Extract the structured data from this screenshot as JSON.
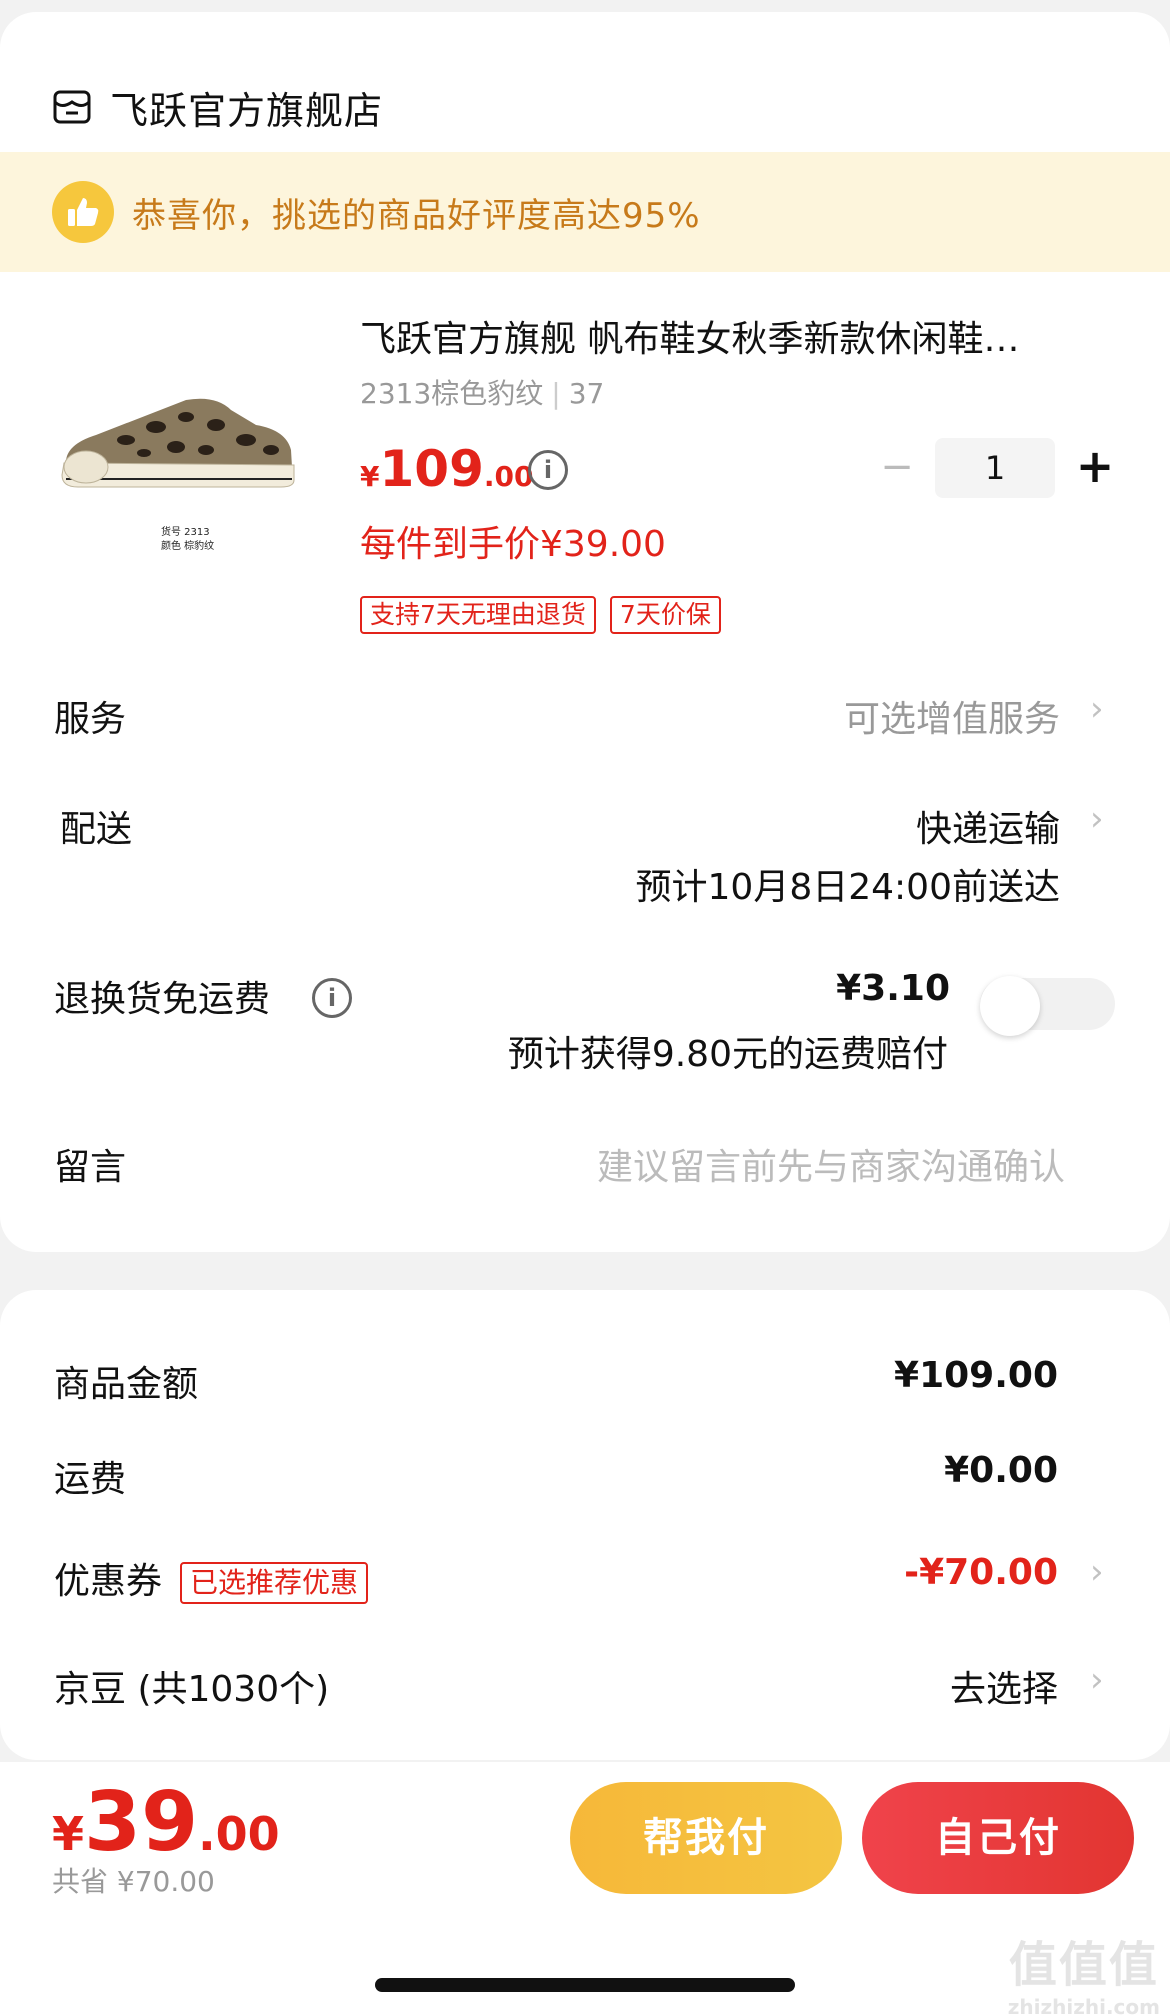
{
  "store": {
    "name": "飞跃官方旗舰店"
  },
  "banner": {
    "text": "恭喜你，挑选的商品好评度高达95%"
  },
  "product": {
    "title": "飞跃官方旗舰 帆布鞋女秋季新款休闲鞋…",
    "spec_color": "2313棕色豹纹",
    "spec_size": "37",
    "image_label_1": "货号  2313",
    "image_label_2": "颜色  棕豹纹",
    "price_currency": "¥",
    "price_int": "109",
    "price_dec": ".00",
    "quantity": "1",
    "each_price": "每件到手价¥39.00",
    "tags": [
      "支持7天无理由退货",
      "7天价保"
    ]
  },
  "service": {
    "label": "服务",
    "value": "可选增值服务"
  },
  "delivery": {
    "label": "配送",
    "method": "快递运输",
    "eta": "预计10月8日24:00前送达"
  },
  "return_shipping": {
    "label": "退换货免运费",
    "price": "¥3.10",
    "note": "预计获得9.80元的运费赔付",
    "enabled": false
  },
  "message": {
    "label": "留言",
    "placeholder": "建议留言前先与商家沟通确认"
  },
  "summary": {
    "goods_label": "商品金额",
    "goods_value": "¥109.00",
    "freight_label": "运费",
    "freight_value": "¥0.00",
    "coupon_label": "优惠券",
    "coupon_badge": "已选推荐优惠",
    "coupon_value": "-¥70.00",
    "jd_label": "京豆 (共1030个)",
    "jd_value": "去选择"
  },
  "footer": {
    "total_currency": "¥",
    "total_int": "39",
    "total_dec": ".00",
    "saved": "共省 ¥70.00",
    "help_pay": "帮我付",
    "self_pay": "自己付"
  },
  "watermark": {
    "line1": "值值值",
    "line2": "zhizhizhi.com"
  },
  "colors": {
    "accent_red": "#e2231a",
    "banner_bg": "#fdf5dc",
    "banner_text": "#c77a1a",
    "help_btn": "#f4c542",
    "self_btn": "#e23531"
  }
}
